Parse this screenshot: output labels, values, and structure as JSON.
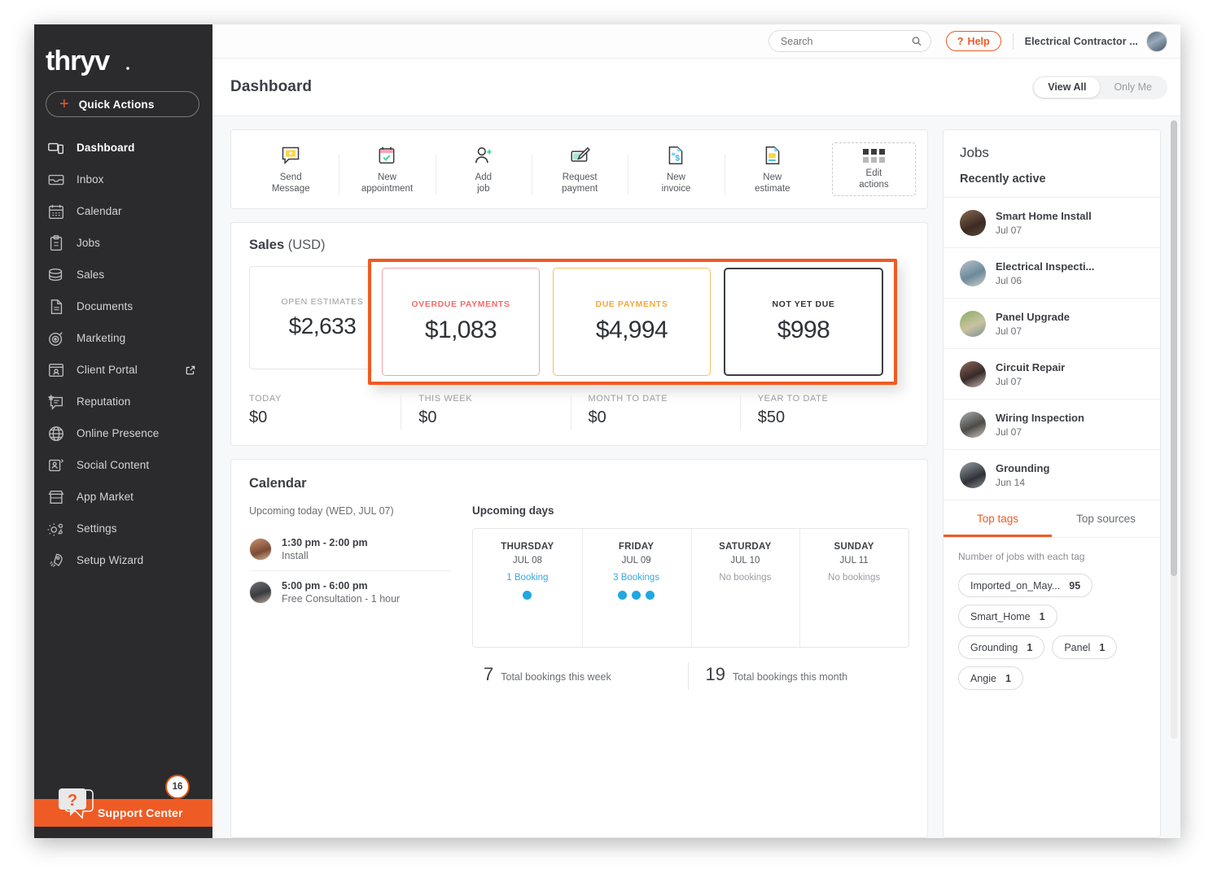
{
  "sidebar": {
    "logo_text": "thryv",
    "quick_actions_label": "Quick Actions",
    "items": [
      {
        "label": "Dashboard",
        "icon": "dashboard-icon",
        "active": true
      },
      {
        "label": "Inbox",
        "icon": "inbox-icon",
        "active": false
      },
      {
        "label": "Calendar",
        "icon": "calendar-icon",
        "active": false
      },
      {
        "label": "Jobs",
        "icon": "clipboard-icon",
        "active": false
      },
      {
        "label": "Sales",
        "icon": "coins-icon",
        "active": false
      },
      {
        "label": "Documents",
        "icon": "document-icon",
        "active": false
      },
      {
        "label": "Marketing",
        "icon": "target-icon",
        "active": false
      },
      {
        "label": "Client Portal",
        "icon": "portal-icon",
        "active": false,
        "external": true
      },
      {
        "label": "Reputation",
        "icon": "review-icon",
        "active": false
      },
      {
        "label": "Online Presence",
        "icon": "globe-icon",
        "active": false
      },
      {
        "label": "Social Content",
        "icon": "social-icon",
        "active": false
      },
      {
        "label": "App Market",
        "icon": "store-icon",
        "active": false
      },
      {
        "label": "Settings",
        "icon": "gears-icon",
        "active": false
      },
      {
        "label": "Setup Wizard",
        "icon": "rocket-icon",
        "active": false
      }
    ],
    "support": {
      "label": "Support Center",
      "badge": "16"
    }
  },
  "topbar": {
    "search_placeholder": "Search",
    "help_label": "Help",
    "account_name": "Electrical Contractor ..."
  },
  "page": {
    "title": "Dashboard",
    "view_all_label": "View All",
    "only_me_label": "Only Me"
  },
  "quick_action_strip": {
    "items": [
      {
        "line1": "Send",
        "line2": "Message",
        "icon": "message-plus-icon"
      },
      {
        "line1": "New",
        "line2": "appointment",
        "icon": "calendar-check-icon"
      },
      {
        "line1": "Add",
        "line2": "job",
        "icon": "user-plus-icon"
      },
      {
        "line1": "Request",
        "line2": "payment",
        "icon": "request-payment-icon"
      },
      {
        "line1": "New",
        "line2": "invoice",
        "icon": "invoice-icon"
      },
      {
        "line1": "New",
        "line2": "estimate",
        "icon": "estimate-icon"
      }
    ],
    "edit": {
      "line1": "Edit",
      "line2": "actions",
      "icon": "grid-dots-icon"
    }
  },
  "sales": {
    "title": "Sales",
    "currency_note": "(USD)",
    "open_estimates": {
      "label": "OPEN ESTIMATES",
      "value": "$2,633"
    },
    "highlight_cards": [
      {
        "label": "OVERDUE PAYMENTS",
        "value": "$1,083",
        "color": "#f26b6b"
      },
      {
        "label": "DUE PAYMENTS",
        "value": "$4,994",
        "color": "#f0a93c"
      },
      {
        "label": "NOT YET DUE",
        "value": "$998",
        "color": "#2f3236"
      }
    ],
    "highlight_border_color": "#f05a22",
    "stats": [
      {
        "label": "TODAY",
        "value": "$0"
      },
      {
        "label": "THIS WEEK",
        "value": "$0"
      },
      {
        "label": "MONTH TO DATE",
        "value": "$0"
      },
      {
        "label": "YEAR TO DATE",
        "value": "$50"
      }
    ]
  },
  "calendar": {
    "title": "Calendar",
    "upcoming_today_label": "Upcoming today",
    "upcoming_today_date": "(WED, JUL 07)",
    "appointments": [
      {
        "time": "1:30 pm - 2:00 pm",
        "desc": "Install"
      },
      {
        "time": "5:00 pm - 6:00 pm",
        "desc": "Free Consultation - 1 hour"
      }
    ],
    "upcoming_days_label": "Upcoming days",
    "days": [
      {
        "name": "THURSDAY",
        "date": "JUL 08",
        "bookings": "1 Booking",
        "dots": 1,
        "has_bookings": true
      },
      {
        "name": "FRIDAY",
        "date": "JUL 09",
        "bookings": "3 Bookings",
        "dots": 3,
        "has_bookings": true
      },
      {
        "name": "SATURDAY",
        "date": "JUL 10",
        "bookings": "No bookings",
        "dots": 0,
        "has_bookings": false
      },
      {
        "name": "SUNDAY",
        "date": "JUL 11",
        "bookings": "No bookings",
        "dots": 0,
        "has_bookings": false
      }
    ],
    "totals": [
      {
        "number": "7",
        "label": "Total bookings this week"
      },
      {
        "number": "19",
        "label": "Total bookings this month"
      }
    ]
  },
  "jobs_panel": {
    "title": "Jobs",
    "subtitle": "Recently active",
    "jobs": [
      {
        "name": "Smart Home Install",
        "date": "Jul 07"
      },
      {
        "name": "Electrical Inspecti...",
        "date": "Jul 06"
      },
      {
        "name": "Panel Upgrade",
        "date": "Jul 07"
      },
      {
        "name": "Circuit Repair",
        "date": "Jul 07"
      },
      {
        "name": "Wiring Inspection",
        "date": "Jul 07"
      },
      {
        "name": "Grounding",
        "date": "Jun 14"
      }
    ],
    "tabs": [
      {
        "label": "Top tags",
        "active": true
      },
      {
        "label": "Top sources",
        "active": false
      }
    ],
    "tags_caption": "Number of jobs with each tag",
    "tags": [
      {
        "name": "Imported_on_May...",
        "count": "95"
      },
      {
        "name": "Smart_Home",
        "count": "1"
      },
      {
        "name": "Grounding",
        "count": "1"
      },
      {
        "name": "Panel",
        "count": "1"
      },
      {
        "name": "Angie",
        "count": "1"
      }
    ]
  }
}
